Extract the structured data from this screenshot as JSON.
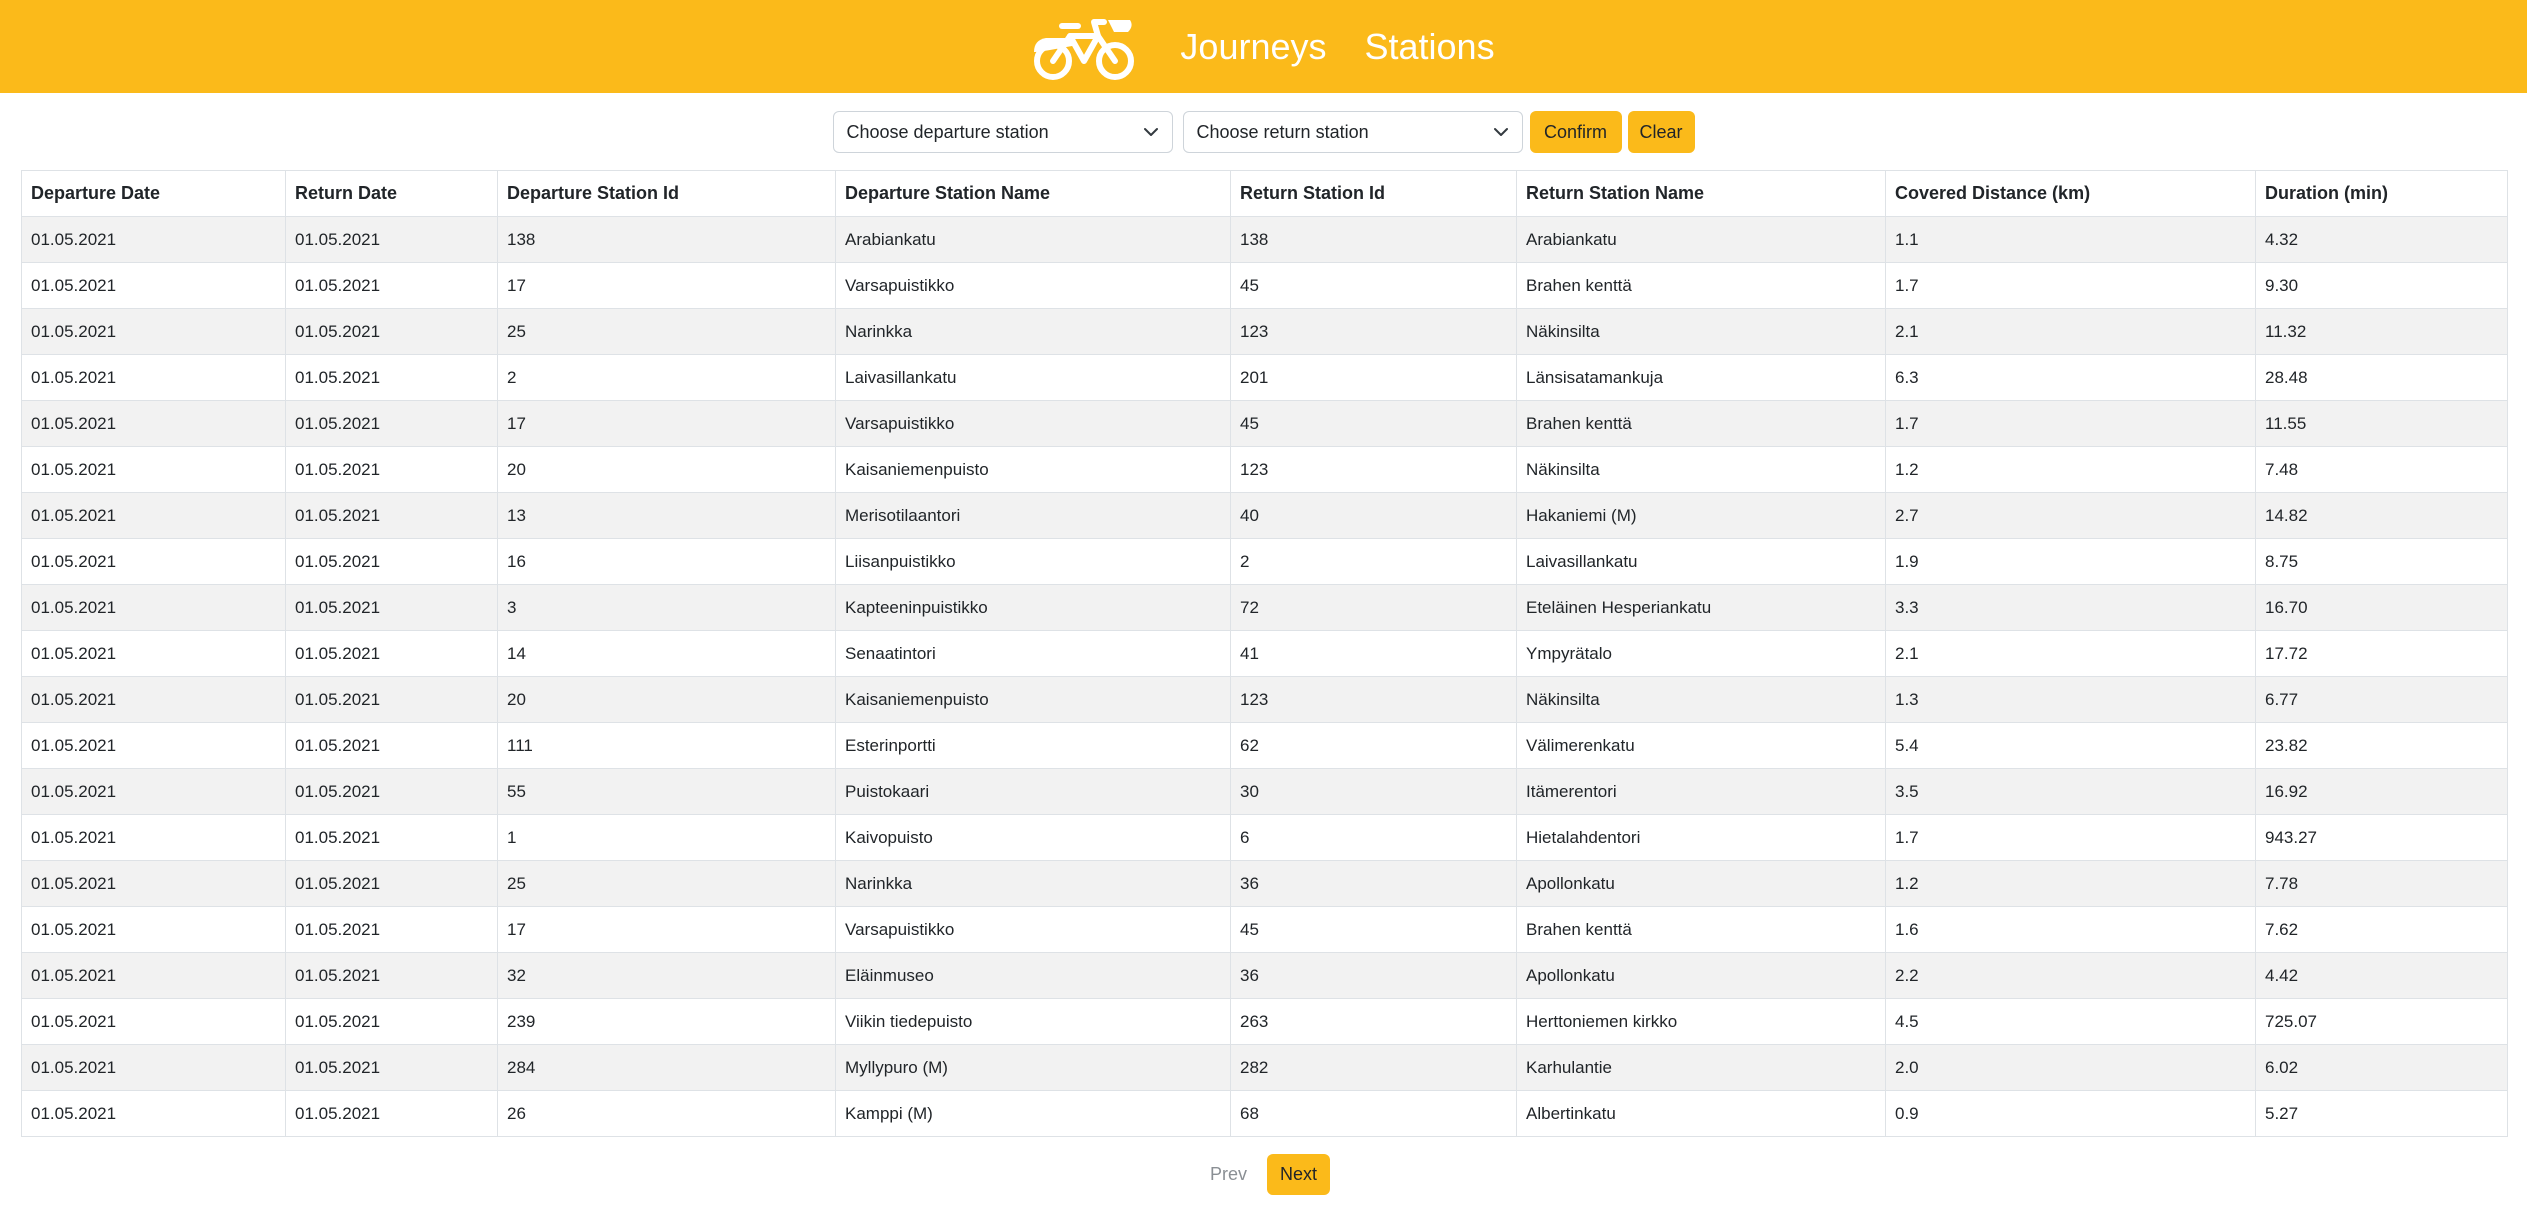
{
  "colors": {
    "accent": "#fbba1a",
    "nav_text": "#ffffff",
    "row_striped": "#f2f2f2"
  },
  "nav": {
    "logo_icon": "bicycle-icon",
    "links": [
      "Journeys",
      "Stations"
    ]
  },
  "filters": {
    "departure_select": "Choose departure station",
    "return_select": "Choose return station",
    "confirm_label": "Confirm",
    "clear_label": "Clear"
  },
  "table": {
    "headers": [
      "Departure Date",
      "Return Date",
      "Departure Station Id",
      "Departure Station Name",
      "Return Station Id",
      "Return Station Name",
      "Covered Distance (km)",
      "Duration (min)"
    ],
    "rows": [
      [
        "01.05.2021",
        "01.05.2021",
        "138",
        "Arabiankatu",
        "138",
        "Arabiankatu",
        "1.1",
        "4.32"
      ],
      [
        "01.05.2021",
        "01.05.2021",
        "17",
        "Varsapuistikko",
        "45",
        "Brahen kenttä",
        "1.7",
        "9.30"
      ],
      [
        "01.05.2021",
        "01.05.2021",
        "25",
        "Narinkka",
        "123",
        "Näkinsilta",
        "2.1",
        "11.32"
      ],
      [
        "01.05.2021",
        "01.05.2021",
        "2",
        "Laivasillankatu",
        "201",
        "Länsisatamankuja",
        "6.3",
        "28.48"
      ],
      [
        "01.05.2021",
        "01.05.2021",
        "17",
        "Varsapuistikko",
        "45",
        "Brahen kenttä",
        "1.7",
        "11.55"
      ],
      [
        "01.05.2021",
        "01.05.2021",
        "20",
        "Kaisaniemenpuisto",
        "123",
        "Näkinsilta",
        "1.2",
        "7.48"
      ],
      [
        "01.05.2021",
        "01.05.2021",
        "13",
        "Merisotilaantori",
        "40",
        "Hakaniemi (M)",
        "2.7",
        "14.82"
      ],
      [
        "01.05.2021",
        "01.05.2021",
        "16",
        "Liisanpuistikko",
        "2",
        "Laivasillankatu",
        "1.9",
        "8.75"
      ],
      [
        "01.05.2021",
        "01.05.2021",
        "3",
        "Kapteeninpuistikko",
        "72",
        "Eteläinen Hesperiankatu",
        "3.3",
        "16.70"
      ],
      [
        "01.05.2021",
        "01.05.2021",
        "14",
        "Senaatintori",
        "41",
        "Ympyrätalo",
        "2.1",
        "17.72"
      ],
      [
        "01.05.2021",
        "01.05.2021",
        "20",
        "Kaisaniemenpuisto",
        "123",
        "Näkinsilta",
        "1.3",
        "6.77"
      ],
      [
        "01.05.2021",
        "01.05.2021",
        "111",
        "Esterinportti",
        "62",
        "Välimerenkatu",
        "5.4",
        "23.82"
      ],
      [
        "01.05.2021",
        "01.05.2021",
        "55",
        "Puistokaari",
        "30",
        "Itämerentori",
        "3.5",
        "16.92"
      ],
      [
        "01.05.2021",
        "01.05.2021",
        "1",
        "Kaivopuisto",
        "6",
        "Hietalahdentori",
        "1.7",
        "943.27"
      ],
      [
        "01.05.2021",
        "01.05.2021",
        "25",
        "Narinkka",
        "36",
        "Apollonkatu",
        "1.2",
        "7.78"
      ],
      [
        "01.05.2021",
        "01.05.2021",
        "17",
        "Varsapuistikko",
        "45",
        "Brahen kenttä",
        "1.6",
        "7.62"
      ],
      [
        "01.05.2021",
        "01.05.2021",
        "32",
        "Eläinmuseo",
        "36",
        "Apollonkatu",
        "2.2",
        "4.42"
      ],
      [
        "01.05.2021",
        "01.05.2021",
        "239",
        "Viikin tiedepuisto",
        "263",
        "Herttoniemen kirkko",
        "4.5",
        "725.07"
      ],
      [
        "01.05.2021",
        "01.05.2021",
        "284",
        "Myllypuro (M)",
        "282",
        "Karhulantie",
        "2.0",
        "6.02"
      ],
      [
        "01.05.2021",
        "01.05.2021",
        "26",
        "Kamppi (M)",
        "68",
        "Albertinkatu",
        "0.9",
        "5.27"
      ]
    ]
  },
  "pagination": {
    "prev_label": "Prev",
    "next_label": "Next"
  }
}
